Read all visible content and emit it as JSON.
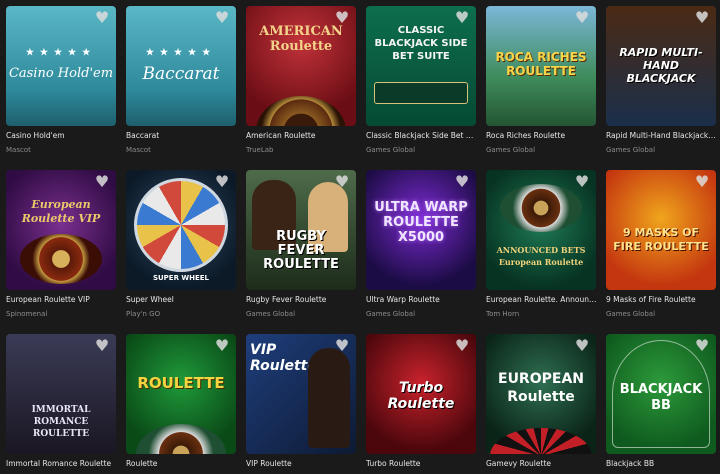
{
  "games": [
    {
      "title": "Casino Hold'em",
      "provider": "Mascot",
      "art": "Casino Hold'em"
    },
    {
      "title": "Baccarat",
      "provider": "Mascot",
      "art": "Baccarat"
    },
    {
      "title": "American Roulette",
      "provider": "TrueLab",
      "art": "AMERICAN Roulette"
    },
    {
      "title": "Classic Blackjack Side Bet Suite",
      "provider": "Games Global",
      "art": "CLASSIC BLACKJACK SIDE BET SUITE"
    },
    {
      "title": "Roca Riches Roulette",
      "provider": "Games Global",
      "art": "ROCA RICHES ROULETTE"
    },
    {
      "title": "Rapid Multi-Hand Blackjack wi...",
      "provider": "Games Global",
      "art": "RAPID MULTI-HAND BLACKJACK"
    },
    {
      "title": "European Roulette VIP",
      "provider": "Spinomenal",
      "art": "European Roulette VIP"
    },
    {
      "title": "Super Wheel",
      "provider": "Play'n GO",
      "art": "SUPER WHEEL"
    },
    {
      "title": "Rugby Fever Roulette",
      "provider": "Games Global",
      "art": "RUGBY FEVER ROULETTE"
    },
    {
      "title": "Ultra Warp Roulette",
      "provider": "Games Global",
      "art": "ULTRA WARP ROULETTE X5000"
    },
    {
      "title": "European Roulette. Announce...",
      "provider": "Tom Horn",
      "art": "ANNOUNCED BETS European Roulette"
    },
    {
      "title": "9 Masks of Fire Roulette",
      "provider": "Games Global",
      "art": "9 MASKS OF FIRE ROULETTE"
    },
    {
      "title": "Immortal Romance Roulette",
      "provider": "",
      "art": "IMMORTAL ROMANCE ROULETTE"
    },
    {
      "title": "Roulette",
      "provider": "",
      "art": "ROULETTE"
    },
    {
      "title": "VIP Roulette",
      "provider": "",
      "art": "VIP Roulette"
    },
    {
      "title": "Turbo Roulette",
      "provider": "",
      "art": "Turbo Roulette"
    },
    {
      "title": "Gamevy Roulette",
      "provider": "",
      "art": "EUROPEAN Roulette"
    },
    {
      "title": "Blackjack BB",
      "provider": "",
      "art": "BLACKJACK BB"
    }
  ],
  "icons": {
    "favorite": "heart-icon"
  },
  "colors": {
    "background": "#1a1a1a",
    "title_text": "#e6e6e6",
    "provider_text": "#8c8c8c"
  }
}
